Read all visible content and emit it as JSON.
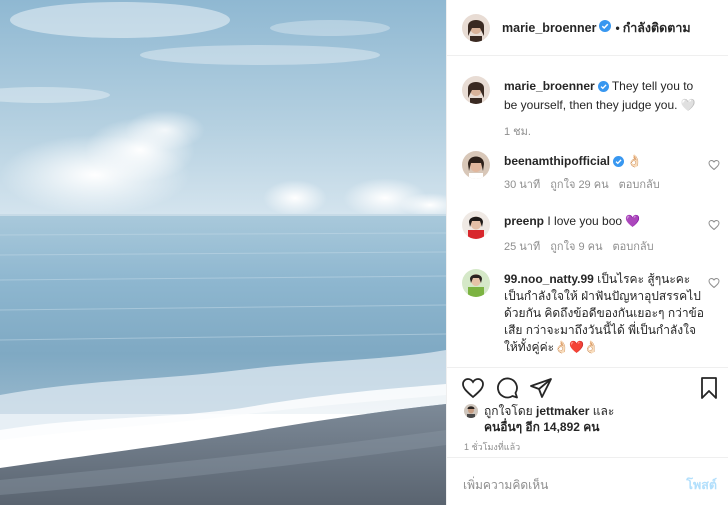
{
  "post": {
    "author": "marie_broenner",
    "header_dot": "•",
    "follow_label": "กำลังติดตาม",
    "photo_icon": "sea-horizon-photo"
  },
  "caption": {
    "user": "marie_broenner",
    "text": "They tell you to be yourself, then they judge you. 🤍",
    "time": "1 ชม."
  },
  "comments": [
    {
      "user": "beenamthipofficial",
      "text": "👌🏻",
      "time": "30 นาที",
      "likes": "ถูกใจ 29 คน",
      "reply": "ตอบกลับ"
    },
    {
      "user": "preenp",
      "text": "I love you boo 💜",
      "time": "25 นาที",
      "likes": "ถูกใจ 9 คน",
      "reply": "ตอบกลับ"
    },
    {
      "user": "99.noo_natty.99",
      "text": "เป็นไรคะ สู้ๆนะคะ เป็นกำลังใจให้ ฝ่าฟันปัญหาอุปสรรคไปด้วยกัน คิดถึงข้อดีของกันเยอะๆ กว่าข้อเสีย กว่าจะมาถึงวันนี้ได้ พี่เป็นกำลังใจให้ทั้งคู่ค่ะ👌🏻❤️👌🏻"
    }
  ],
  "likes": {
    "prefix": "ถูกใจโดย",
    "user": "jettmaker",
    "and": "และ",
    "others": "คนอื่นๆ อีก 14,892 คน"
  },
  "timestamp": "1 ชั่วโมงที่แล้ว",
  "add_comment": {
    "placeholder": "เพิ่มความคิดเห็น",
    "post_label": "โพสต์"
  },
  "colors": {
    "verified": "#3897f0",
    "link_disabled": "#b2dffc",
    "muted": "#8e8e8e"
  }
}
